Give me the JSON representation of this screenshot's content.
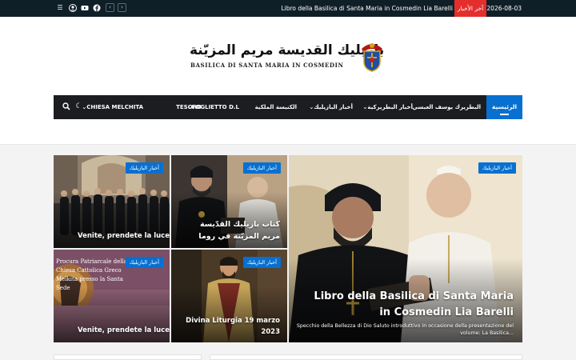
{
  "topbar": {
    "date": "2026-08-03",
    "ticker_label": "آخر الأخبار",
    "ticker_text": "Libro della Basilica di Santa Maria in Cosmedin Lia Barelli",
    "prev_icon": "chevron-left-icon",
    "next_icon": "chevron-right-icon"
  },
  "header": {
    "logo_arabic": "بازيليك القديسة مريم المزيّنة",
    "logo_english": "BASILICA DI SANTA MARIA IN COSMEDIN"
  },
  "nav": {
    "items": [
      {
        "label": "الرئيسية",
        "active": true
      },
      {
        "label": "البطريرك يوسف العبسي",
        "dropdown": false
      },
      {
        "label": "أخبار البطريركية",
        "dropdown": true
      },
      {
        "label": "أخبار البازيليك",
        "dropdown": true
      },
      {
        "label": "الكنيسة الملكية",
        "dropdown": false
      },
      {
        "label": "FOGLIETTO D.L",
        "dropdown": true
      },
      {
        "label": "TESORO",
        "dropdown": false
      },
      {
        "label": "CHIESA MELCHITA",
        "dropdown": true
      }
    ]
  },
  "grid": {
    "badge": "أخبار البازيليك",
    "featured": {
      "title": "Libro della Basilica di Santa Maria in Cosmedin Lia Barelli",
      "excerpt": "Specchio della Bellezza di Dio Saluto introduttivo in occasione della presentazione del volume: La Basilica..."
    },
    "tiles": [
      {
        "title": "Venite, prendete la luce"
      },
      {
        "title": "كتاب بازيليك القدّيسة مريم المزيّنة في روما"
      },
      {
        "title": "Venite, prendete la luce",
        "overlay_text": "Procura Patriarcale della Chiesa Cattolica Greco Melkita presso la Santa Sede"
      },
      {
        "title": "Divina Liturgia 19 marzo 2023"
      }
    ]
  },
  "colors": {
    "accent": "#0870d0",
    "nav_bg": "#1b1d20",
    "topbar_bg": "#0f1f28",
    "ticker_red": "#e42d2d"
  }
}
